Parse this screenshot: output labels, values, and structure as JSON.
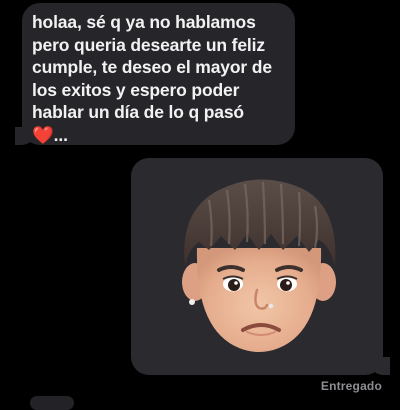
{
  "conversation": {
    "incoming_message": {
      "text": "holaa, sé q ya no hablamos\npero queria desearte un feliz\ncumple, te deseo el mayor de\nlos exitos y espero poder\nhablar un día de lo q pasó",
      "emoji": "❤️",
      "trailing": "..."
    },
    "outgoing_message": {
      "memoji_icon": "sad-memoji-sticker"
    },
    "delivery_status": "Entregado"
  },
  "colors": {
    "background": "#000000",
    "incoming_bubble": "#26252a",
    "outgoing_bubble": "#2b2a2f",
    "text": "#f2f2f2",
    "status_text": "#8e8e93"
  }
}
